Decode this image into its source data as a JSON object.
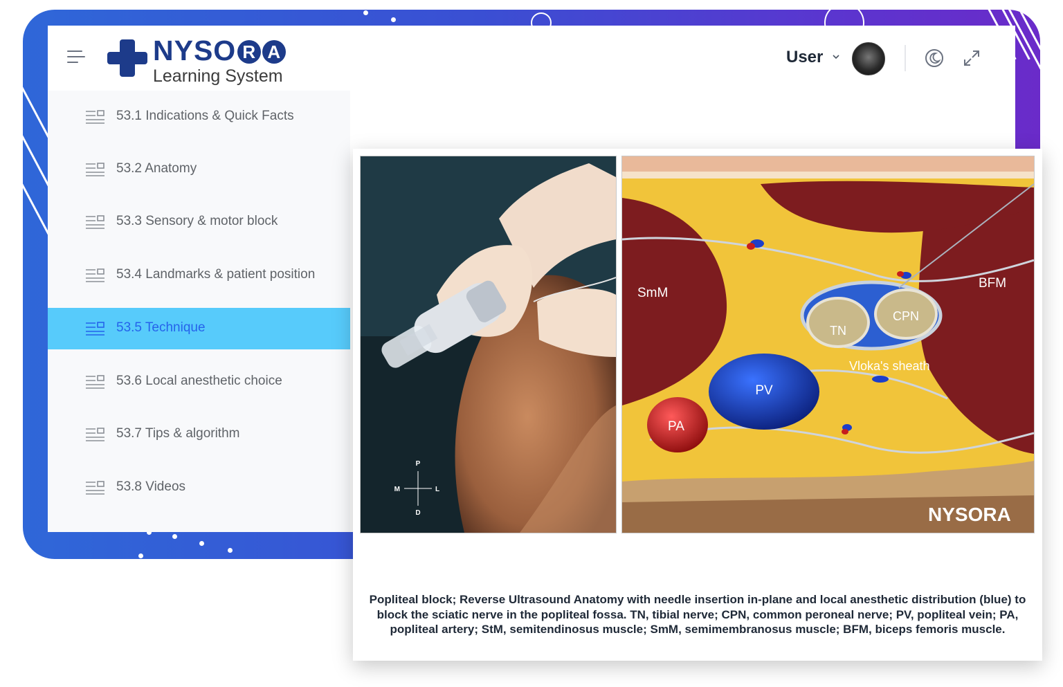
{
  "brand": {
    "name_part1": "NYSO",
    "name_r": "R",
    "name_a": "A",
    "subtitle": "Learning System"
  },
  "header": {
    "user_label": "User"
  },
  "sidebar": {
    "items": [
      {
        "label": "53.1 Indications & Quick Facts"
      },
      {
        "label": "53.2 Anatomy"
      },
      {
        "label": "53.3 Sensory & motor block"
      },
      {
        "label": "53.4 Landmarks & patient position"
      },
      {
        "label": "53.5 Technique"
      },
      {
        "label": "53.6 Local anesthetic choice"
      },
      {
        "label": "53.7 Tips & algorithm"
      },
      {
        "label": "53.8 Videos"
      }
    ],
    "active_index": 4
  },
  "figure": {
    "photo_orientation": {
      "top": "P",
      "left": "M",
      "right": "L",
      "bottom": "D"
    },
    "labels": {
      "smm": "SmM",
      "bfm": "BFM",
      "tn": "TN",
      "cpn": "CPN",
      "sheath": "Vloka's sheath",
      "pv": "PV",
      "pa": "PA"
    },
    "watermark_part1": "NYSO",
    "watermark_r": "R",
    "watermark_a": "A",
    "caption": "Popliteal block; Reverse Ultrasound Anatomy with needle insertion in-plane and local anesthetic distribution (blue) to block the sciatic nerve in the popliteal fossa. TN, tibial nerve; CPN, common peroneal nerve; PV, popliteal vein; PA, popliteal artery; StM, semitendinosus muscle; SmM, semimembranosus muscle; BFM, biceps femoris muscle."
  },
  "colors": {
    "active_item": "#57cbfb",
    "brand_blue": "#1d3b8a",
    "frame_start": "#2f67d8",
    "frame_end": "#6a2bc9"
  },
  "icons": {
    "menu": "menu-icon",
    "toc_item": "toc-list-icon",
    "dark_mode": "moon-icon",
    "fullscreen": "expand-icon",
    "user_menu": "chevron-down-icon"
  }
}
